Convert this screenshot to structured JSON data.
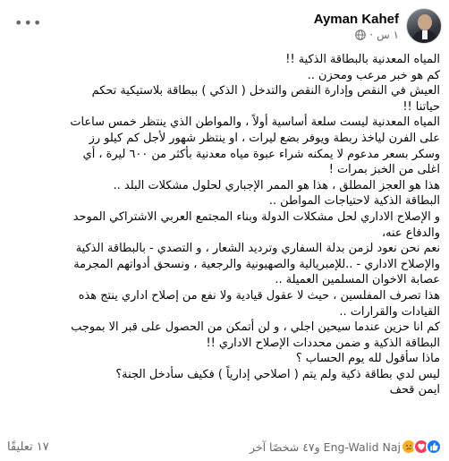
{
  "post": {
    "author": "Ayman Kahef",
    "time": "١ س",
    "time_separator": "·",
    "menu_icon": "more-dots-icon",
    "lines": [
      "المياه المعدنية بالبطاقة الذكية !!",
      "كم هو خبر مرعب ومحزن ..",
      "العيش في النقص وإدارة النقص والتدخل ( الذكي ) ببطاقة بلاستيكية تحكم",
      "حياتنا !!",
      "المياه المعدنية ليست سلعة أساسية أولاً ، والمواطن الذي ينتظر خمس ساعات",
      "على الفرن لياخذ ربطة ويوفر بضع ليرات ، او ينتظر شهور لأجل كم كيلو رز",
      "وسكر بسعر مدعوم لا يمكنه شراء عبوة مياه معدنية بأكثر من ٦٠٠ ليرة ، أي",
      "اغلى من الخبز بمرات !",
      "هذا هو العجز المطلق ، هذا هو الممر الإجباري لحلول مشكلات البلد ..",
      "البطاقة الذكية لاحتياجات المواطن ..",
      "و الإصلاح الاداري لحل مشكلات الدولة وبناء المجتمع العربي الاشتراكي الموحد",
      "والدفاع عنه،",
      "نعم نحن نعود لزمن بدلة السفاري وترديد الشعار ، و التصدي - بالبطاقة الذكية",
      "والإصلاح الاداري - ..للإمبريالية والصهيونية والرجعية ، ونسحق أدواتهم المجرمة",
      "عصابة الاخوان المسلمين العميلة ..",
      "هذا تصرف المفلسين ، حيث لا عقول قيادية ولا نفع من إصلاح اداري ينتج هذه",
      "القيادات والقرارات ..",
      "كم انا حزين عندما سيحين اجلي ، و لن أتمكن من الحصول على قبر الا بموجب",
      "البطاقة الذكية و ضمن محددات الإصلاح الاداري !!",
      "ماذا سأقول لله يوم الحساب ؟",
      "ليس لدي بطاقة ذكية ولم يتم ( اصلاحي إدارياً ) فكيف سأدخل الجنة؟",
      "ايمن قحف"
    ]
  },
  "footer": {
    "reactions_text": "Eng-Walid Naj و٤٧ شخصًا آخر",
    "comments": "١٧ تعليقًا",
    "reaction_icons": [
      "like-icon",
      "love-icon",
      "sad-icon"
    ]
  },
  "colors": {
    "text": "#050505",
    "secondary": "#65676b",
    "like": "#1877f2",
    "love": "#f33e58",
    "sad": "#f7b125"
  }
}
